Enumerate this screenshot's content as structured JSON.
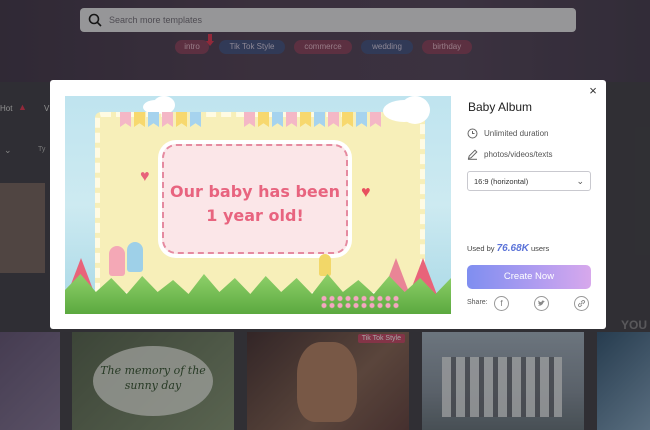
{
  "search": {
    "placeholder": "Search more templates"
  },
  "tags": [
    "intro",
    "Tik Tok Style",
    "commerce",
    "wedding",
    "birthday"
  ],
  "background": {
    "hot_label": "Hot",
    "v_label": "V",
    "type_label": "Ty",
    "memory_text": "The memory of the sunny day",
    "tiktok_badge": "Tik Tok Style",
    "you_text": "YOU"
  },
  "modal": {
    "title": "Baby Album",
    "duration": "Unlimited duration",
    "content": "photos/videos/texts",
    "aspect_ratio": "16:9 (horizontal)",
    "used_prefix": "Used by",
    "used_count": "76.68K",
    "used_suffix": "users",
    "create_button": "Create Now",
    "share_label": "Share:",
    "close": "×",
    "preview_text_line1": "Our baby has been",
    "preview_text_line2": "1 year old!"
  },
  "colors": {
    "accent_start": "#7f8ef0",
    "accent_end": "#d7a8ec",
    "used_count": "#5b73d8",
    "preview_text": "#e8647f"
  },
  "icons": {
    "search": "search-icon",
    "duration": "clock-icon",
    "content": "pencil-icon",
    "facebook": "facebook-icon",
    "twitter": "twitter-icon",
    "link": "link-icon",
    "close": "close-icon"
  }
}
